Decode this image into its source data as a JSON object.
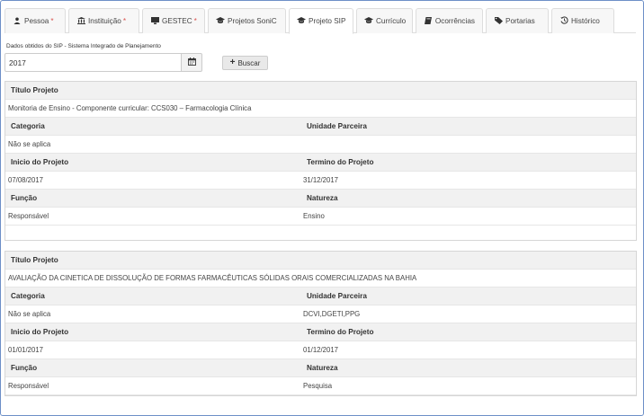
{
  "tabs": [
    {
      "label": "Pessoa",
      "icon": "user-icon",
      "required": "*"
    },
    {
      "label": "Instituição",
      "icon": "bank-icon",
      "required": "*"
    },
    {
      "label": "GESTEC",
      "icon": "monitor-icon",
      "required": "*"
    },
    {
      "label": "Projetos SoniC",
      "icon": "graduation-cap-icon",
      "required": ""
    },
    {
      "label": "Projeto SIP",
      "icon": "graduation-cap-icon",
      "required": ""
    },
    {
      "label": "Currículo",
      "icon": "graduation-cap-icon",
      "required": ""
    },
    {
      "label": "Ocorrências",
      "icon": "book-icon",
      "required": ""
    },
    {
      "label": "Portarias",
      "icon": "tags-icon",
      "required": ""
    },
    {
      "label": "Histórico",
      "icon": "history-icon",
      "required": ""
    }
  ],
  "search": {
    "label": "Dados obtidos do SIP - Sistema Integrado de Planejamento",
    "year_value": "2017",
    "button_label": "Buscar"
  },
  "headers": {
    "titulo": "Título Projeto",
    "categoria": "Categoria",
    "unidade": "Unidade Parceira",
    "inicio": "Inicio do Projeto",
    "termino": "Termino do Projeto",
    "funcao": "Função",
    "natureza": "Natureza"
  },
  "projects": [
    {
      "titulo": "Monitoria de Ensino - Componente curricular: CCS030 – Farmacologia Clínica",
      "categoria": "Não se aplica",
      "unidade": "",
      "inicio": "07/08/2017",
      "termino": "31/12/2017",
      "funcao": "Responsável",
      "natureza": "Ensino"
    },
    {
      "titulo": "AVALIAÇÃO DA CINETICA DE DISSOLUÇÃO DE FORMAS FARMACÊUTICAS SÓLIDAS ORAIS COMERCIALIZADAS NA BAHIA",
      "categoria": "Não se aplica",
      "unidade": "DCVI,DGETI,PPG",
      "inicio": "01/01/2017",
      "termino": "01/12/2017",
      "funcao": "Responsável",
      "natureza": "Pesquisa"
    }
  ],
  "colors": {
    "frame_border": "#6d8fc7",
    "required": "#d9534f",
    "header_bg": "#f1f1f1"
  }
}
